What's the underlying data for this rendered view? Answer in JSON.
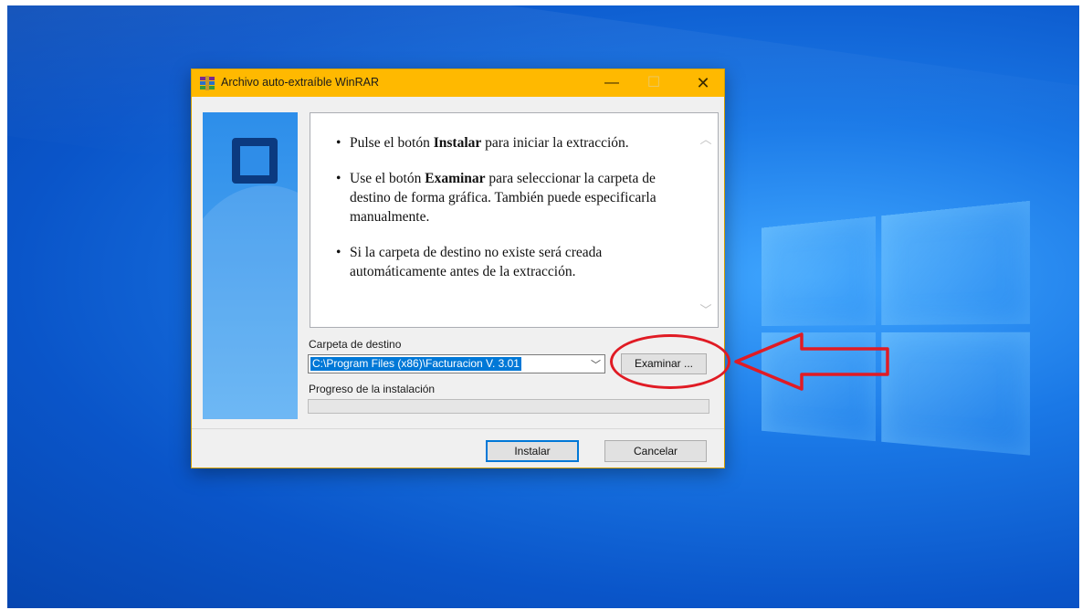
{
  "window": {
    "title": "Archivo auto-extraíble WinRAR",
    "controls": {
      "minimize": "—",
      "maximize": "☐",
      "close": "✕"
    }
  },
  "instructions": [
    {
      "before": "Pulse el botón ",
      "bold": "Instalar",
      "after": " para iniciar la extracción."
    },
    {
      "before": "Use el botón ",
      "bold": "Examinar",
      "after": " para seleccionar la carpeta de destino de forma gráfica. También puede especificarla manualmente."
    },
    {
      "before": "",
      "bold": "",
      "after": "Si la carpeta de destino no existe será creada automáticamente antes de la extracción."
    }
  ],
  "destination": {
    "label": "Carpeta de destino",
    "value": "C:\\Program Files (x86)\\Facturacion V. 3.01"
  },
  "progress": {
    "label": "Progreso de la instalación",
    "value": 0
  },
  "buttons": {
    "browse": "Examinar ...",
    "install": "Instalar",
    "cancel": "Cancelar"
  },
  "colors": {
    "titlebar": "#ffb900",
    "annotation": "#e01b24",
    "selection": "#0078d7"
  }
}
